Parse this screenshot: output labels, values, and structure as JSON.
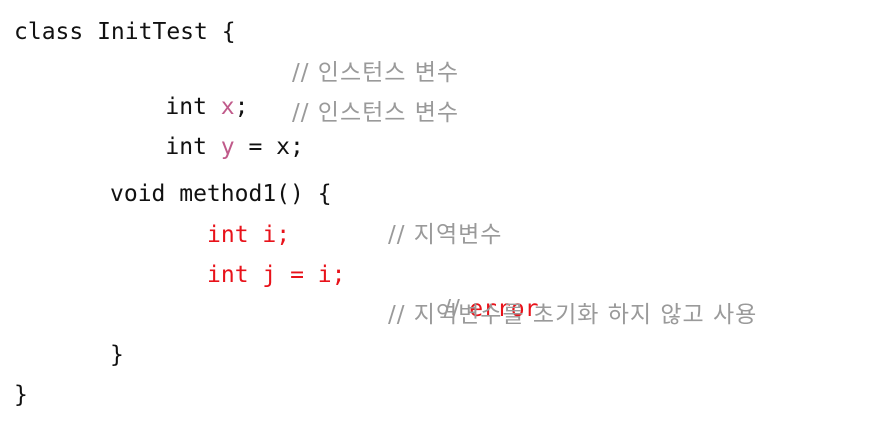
{
  "colors": {
    "text": "#111111",
    "comment": "#9a9a9a",
    "instance_var": "#c05a8a",
    "error": "#e8121a",
    "background": "#ffffff"
  },
  "code": {
    "line1": "class InitTest {",
    "line2": {
      "keyword": "int ",
      "var": "x",
      "rest": ";",
      "comment": "// 인스턴스 변수"
    },
    "line3": {
      "keyword": "int ",
      "var": "y",
      "rest": " = x;",
      "comment": "// 인스턴스 변수"
    },
    "line4": "void method1() {",
    "line5": {
      "code": "int i;",
      "comment": "// 지역변수"
    },
    "line6": {
      "code": "int j = i;",
      "comment_prefix": "// ",
      "comment_error": "error"
    },
    "line7": {
      "comment": "// 지역변수를 초기화 하지 않고 사용"
    },
    "line8": "}",
    "line9": "}"
  }
}
